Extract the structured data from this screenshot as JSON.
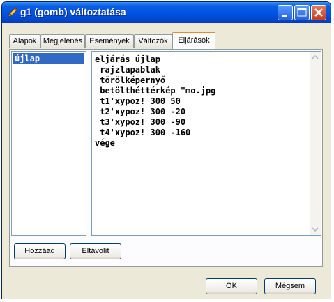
{
  "window": {
    "title": "g1 (gomb) változtatása"
  },
  "tabs": [
    {
      "label": "Alapok"
    },
    {
      "label": "Megjelenés"
    },
    {
      "label": "Események"
    },
    {
      "label": "Változók"
    },
    {
      "label": "Eljárások"
    }
  ],
  "active_tab": "Eljárások",
  "procedures": {
    "selected": "újlap"
  },
  "editor": {
    "lines": [
      "eljárás újlap",
      " rajzlapablak",
      " törölképernyő",
      " betölthéttérkép \"mo.jpg",
      " t1'xypoz! 300 50",
      " t2'xypoz! 300 -20",
      " t3'xypoz! 300 -90",
      " t4'xypoz! 300 -160",
      "vége"
    ]
  },
  "buttons": {
    "add": "Hozzáad",
    "remove": "Eltávolít",
    "ok": "OK",
    "cancel": "Mégsem"
  },
  "icons": {
    "app": "pencil-icon",
    "minimize": "minimize-icon",
    "maximize": "maximize-icon",
    "close": "close-icon",
    "scroll_up": "scroll-up-arrow-icon",
    "scroll_down": "scroll-down-arrow-icon"
  },
  "colors": {
    "titlebar": "#0055e5",
    "selection": "#316ac5",
    "active_tab_accent": "#e68b2c",
    "close_button": "#c4401e"
  }
}
